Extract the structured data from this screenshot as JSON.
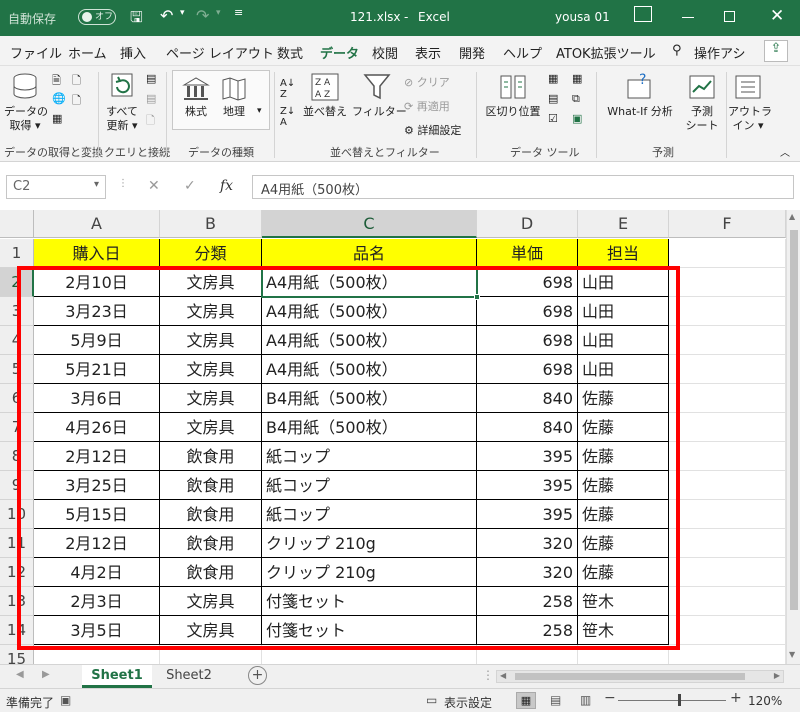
{
  "titlebar": {
    "autosave_label": "自動保存",
    "autosave_state": "オフ",
    "filename": "121.xlsx",
    "separator": "-",
    "app": "Excel",
    "user": "yousa 01"
  },
  "tabs": [
    "ファイル",
    "ホーム",
    "挿入",
    "ページ レイアウト",
    "数式",
    "データ",
    "校閲",
    "表示",
    "開発",
    "ヘルプ",
    "ATOK拡張ツール"
  ],
  "active_tab": "データ",
  "search_label": "操作アシ",
  "ribbon": {
    "get_data": "データの",
    "get_data2": "取得",
    "refresh_all": "すべて",
    "refresh_all2": "更新",
    "stocks": "株式",
    "geography": "地理",
    "sort": "並べ替え",
    "filter": "フィルター",
    "clear": "クリア",
    "reapply": "再適用",
    "advanced": "詳細設定",
    "text_to_columns": "区切り位置",
    "what_if": "What-If 分析",
    "forecast": "予測",
    "forecast2": "シート",
    "outline": "アウトラ",
    "outline2": "イン",
    "groups": [
      "データの取得と変換",
      "クエリと接続",
      "データの種類",
      "並べ替えとフィルター",
      "データ ツール",
      "予測"
    ]
  },
  "formula_bar": {
    "name_box": "C2",
    "fx": "fx",
    "content": "A4用紙（500枚）"
  },
  "columns": [
    "A",
    "B",
    "C",
    "D",
    "E",
    "F"
  ],
  "header_row": [
    "購入日",
    "分類",
    "品名",
    "単価",
    "担当"
  ],
  "rows": [
    [
      "2月10日",
      "文房具",
      "A4用紙（500枚）",
      "698",
      "山田"
    ],
    [
      "3月23日",
      "文房具",
      "A4用紙（500枚）",
      "698",
      "山田"
    ],
    [
      "5月9日",
      "文房具",
      "A4用紙（500枚）",
      "698",
      "山田"
    ],
    [
      "5月21日",
      "文房具",
      "A4用紙（500枚）",
      "698",
      "山田"
    ],
    [
      "3月6日",
      "文房具",
      "B4用紙（500枚）",
      "840",
      "佐藤"
    ],
    [
      "4月26日",
      "文房具",
      "B4用紙（500枚）",
      "840",
      "佐藤"
    ],
    [
      "2月12日",
      "飲食用",
      "紙コップ",
      "395",
      "佐藤"
    ],
    [
      "3月25日",
      "飲食用",
      "紙コップ",
      "395",
      "佐藤"
    ],
    [
      "5月15日",
      "飲食用",
      "紙コップ",
      "395",
      "佐藤"
    ],
    [
      "2月12日",
      "飲食用",
      "クリップ 210g",
      "320",
      "佐藤"
    ],
    [
      "4月2日",
      "飲食用",
      "クリップ 210g",
      "320",
      "佐藤"
    ],
    [
      "2月3日",
      "文房具",
      "付箋セット",
      "258",
      "笹木"
    ],
    [
      "3月5日",
      "文房具",
      "付箋セット",
      "258",
      "笹木"
    ]
  ],
  "row_numbers": [
    "1",
    "2",
    "3",
    "4",
    "5",
    "6",
    "7",
    "8",
    "9",
    "10",
    "11",
    "12",
    "13",
    "14",
    "15"
  ],
  "sheets": [
    "Sheet1",
    "Sheet2"
  ],
  "status": {
    "ready": "準備完了",
    "display_settings": "表示設定",
    "zoom": "120%"
  },
  "colors": {
    "excel_green": "#217346",
    "header_fill": "#ffff00",
    "highlight": "#ff0000"
  }
}
